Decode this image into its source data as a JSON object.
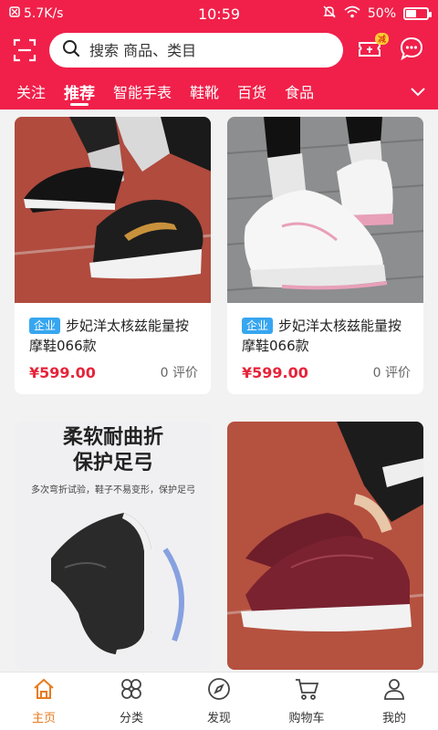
{
  "status": {
    "speed": "5.7K/s",
    "time": "10:59",
    "battery": "50%",
    "battery_level": 0.5
  },
  "search": {
    "placeholder": "搜索 商品、类目",
    "cart_badge": "减"
  },
  "tabs": [
    {
      "label": "关注",
      "active": false
    },
    {
      "label": "推荐",
      "active": true
    },
    {
      "label": "智能手表",
      "active": false
    },
    {
      "label": "鞋靴",
      "active": false
    },
    {
      "label": "百货",
      "active": false
    },
    {
      "label": "食品",
      "active": false
    }
  ],
  "products": [
    {
      "tag": "企业",
      "title": "步妃洋太核兹能量按摩鞋066款",
      "price": "¥599.00",
      "reviews": "0 评价"
    },
    {
      "tag": "企业",
      "title": "步妃洋太核兹能量按摩鞋066款",
      "price": "¥599.00",
      "reviews": "0 评价"
    }
  ],
  "promo_card": {
    "headline1": "柔软耐曲折",
    "headline2": "保护足弓",
    "subline": "多次弯折试验，鞋子不易变形，保护足弓"
  },
  "bottom_nav": [
    {
      "label": "主页",
      "icon": "home-icon",
      "active": true
    },
    {
      "label": "分类",
      "icon": "category-icon",
      "active": false
    },
    {
      "label": "发现",
      "icon": "compass-icon",
      "active": false
    },
    {
      "label": "购物车",
      "icon": "cart-icon",
      "active": false
    },
    {
      "label": "我的",
      "icon": "user-icon",
      "active": false
    }
  ],
  "colors": {
    "brand": "#f0204a",
    "price": "#e6243a",
    "nav_active": "#e87b1e",
    "corp_tag": "#37a6f0"
  }
}
